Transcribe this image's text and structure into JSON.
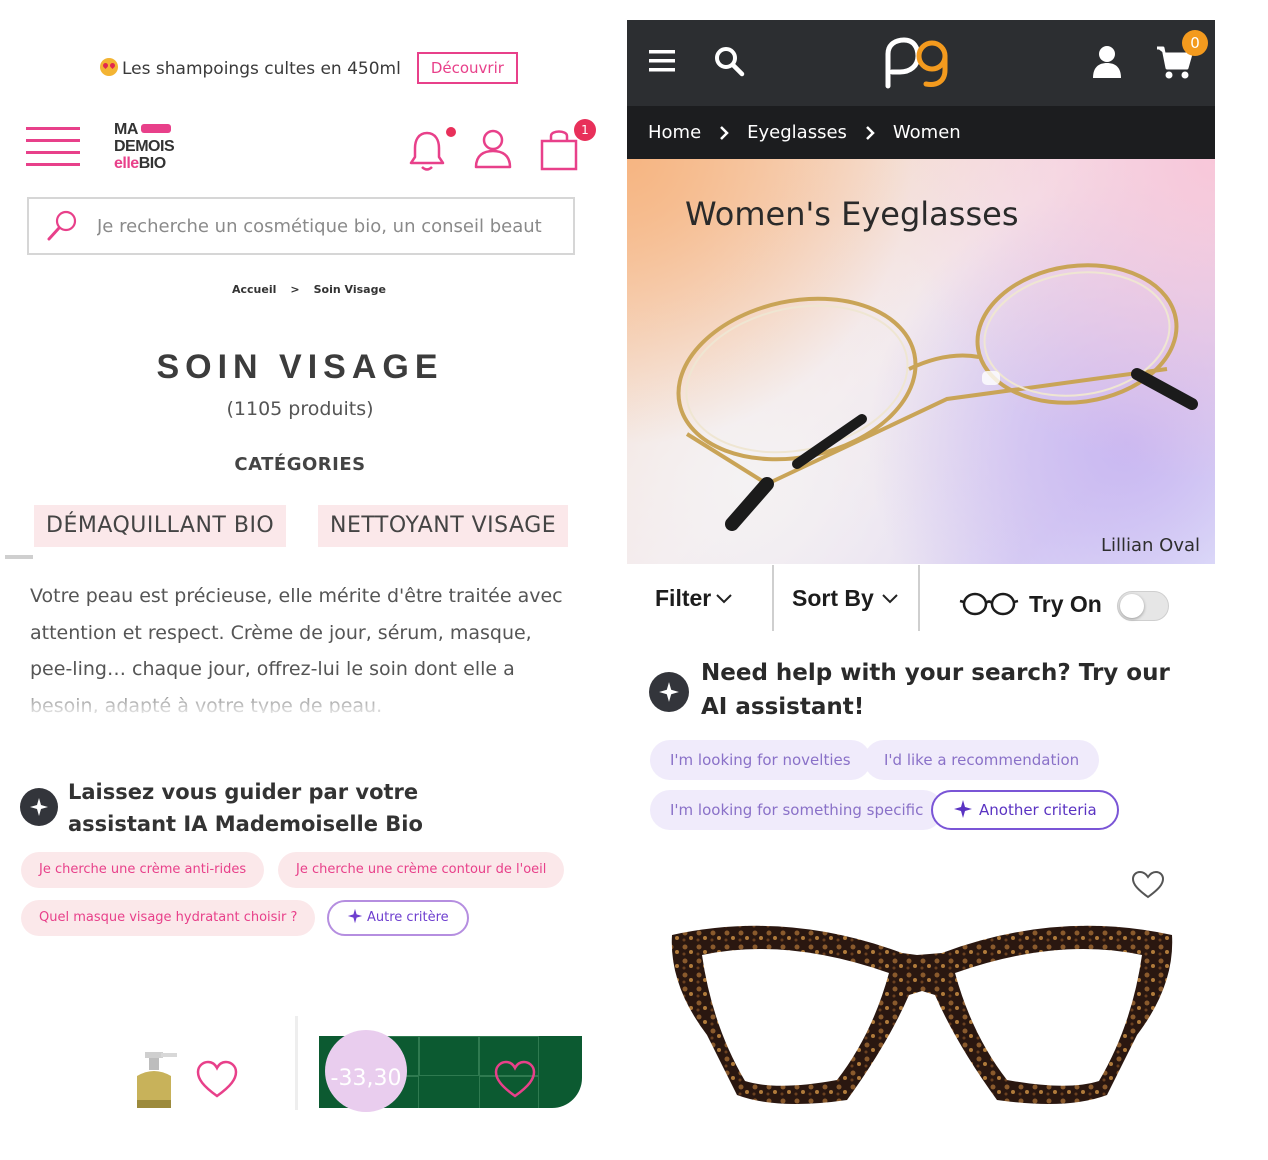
{
  "left": {
    "promo": {
      "text": "Les shampoings cultes en 450ml",
      "button": "Découvrir"
    },
    "logo": {
      "line1": "MA",
      "line2": "DEMOIS",
      "line3a": "elle",
      "line3b": "BIO"
    },
    "cart_count": "1",
    "search": {
      "placeholder": "Je recherche un cosmétique bio, un conseil beaut"
    },
    "breadcrumb": {
      "home": "Accueil",
      "sep": ">",
      "current": "Soin Visage"
    },
    "title": "SOIN VISAGE",
    "count": "(1105 produits)",
    "categories_title": "CATÉGORIES",
    "categories": [
      "DÉMAQUILLANT BIO",
      "NETTOYANT VISAGE"
    ],
    "description": "Votre peau est précieuse, elle mérite d'être traitée avec attention et respect. Crème de jour, sérum, masque, pee-ling… chaque jour, offrez-lui le soin dont elle a besoin, adapté à votre type de peau.",
    "ai": {
      "title": "Laissez vous guider par votre assistant IA Mademoiselle Bio",
      "chips": [
        "Je cherche une crème anti-rides",
        "Je cherche une crème contour de l'oeil",
        "Quel masque visage hydratant choisir ?"
      ],
      "other": "Autre critère"
    },
    "product_price": "-33,30"
  },
  "right": {
    "cart_count": "0",
    "breadcrumb": [
      "Home",
      "Eyeglasses",
      "Women"
    ],
    "hero": {
      "title": "Women's Eyeglasses",
      "caption": "Lillian Oval"
    },
    "filters": {
      "filter": "Filter",
      "sort": "Sort By",
      "try_on": "Try On",
      "try_on_enabled": false
    },
    "ai": {
      "title": "Need help with your search? Try our AI assistant!",
      "chips": [
        "I'm looking for novelties",
        "I'd like a recommendation",
        "I'm looking for something specific"
      ],
      "other": "Another criteria"
    }
  },
  "colors": {
    "mb_pink": "#e8408a",
    "chip_pink_bg": "#fbe8ea",
    "nav_dark": "#2c2e31",
    "accent_orange": "#f39a1e",
    "violet": "#7a55d6"
  }
}
